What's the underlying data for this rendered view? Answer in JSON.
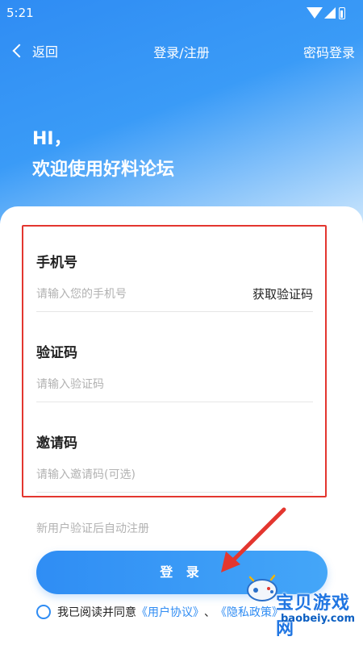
{
  "status": {
    "time": "5:21"
  },
  "nav": {
    "back_label": "返回",
    "title": "登录/注册",
    "action_label": "密码登录"
  },
  "greeting": {
    "line1": "HI，",
    "line2": "欢迎使用好料论坛"
  },
  "form": {
    "phone": {
      "label": "手机号",
      "placeholder": "请输入您的手机号",
      "get_code_label": "获取验证码"
    },
    "code": {
      "label": "验证码",
      "placeholder": "请输入验证码"
    },
    "invite": {
      "label": "邀请码",
      "placeholder": "请输入邀请码(可选)"
    }
  },
  "hint": "新用户验证后自动注册",
  "login_button": "登 录",
  "agreement": {
    "prefix": "我已阅读并同意",
    "user_agreement": "《用户协议》",
    "separator": "、",
    "privacy_policy": "《隐私政策》"
  },
  "watermark": {
    "title": "宝贝游戏网",
    "subtitle": "baobeiy.com"
  },
  "colors": {
    "primary": "#2f8cf3",
    "highlight_border": "#e3362f",
    "arrow": "#e3362f"
  }
}
